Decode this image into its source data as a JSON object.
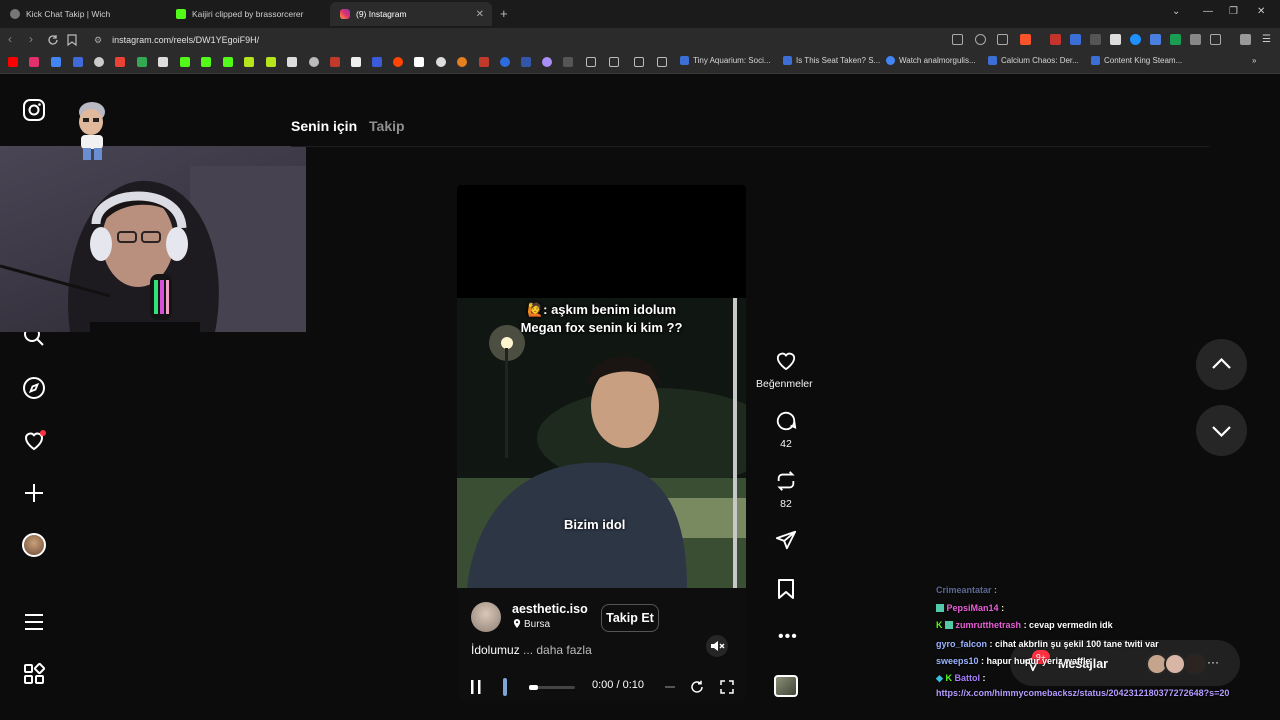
{
  "browser": {
    "tabs": [
      {
        "title": "Kick Chat Takip | Wich"
      },
      {
        "title": "Kaijiri clipped by brassorcerer"
      },
      {
        "title": "(9) Instagram"
      }
    ],
    "url": "instagram.com/reels/DW1YEgoiF9H/",
    "bookmarks": [
      "Tiny Aquarium: Soci...",
      "Is This Seat Taken? S...",
      "Watch analmorgulis...",
      "Calcium Chaos: Der...",
      "Content King Steam..."
    ]
  },
  "instagram": {
    "feed_tabs": {
      "for_you": "Senin için",
      "following": "Takip"
    },
    "reel": {
      "caption_line1": ": aşkım benim idolum",
      "caption_line2": "Megan fox senin ki kim ??",
      "caption_emoji": "🙋",
      "caption_mid": "Bizim idol",
      "username": "aesthetic.iso",
      "location": "Bursa",
      "follow_label": "Takip Et",
      "description": "İdolumuz",
      "more_label": "... daha fazla",
      "time": "0:00 / 0:10",
      "progress": 0.0
    },
    "actions": {
      "likes_label": "Beğenmeler",
      "comments_count": "42",
      "reposts_count": "82"
    },
    "messages": {
      "label": "Mesajlar",
      "badge": "9+"
    }
  },
  "chat": [
    {
      "nick": "Crimeantatar",
      "msg": ":"
    },
    {
      "nick": "PepsiMan14",
      "msg": ":"
    },
    {
      "nick": "zumrutthetrash",
      "msg": ": cevap vermedin idk"
    },
    {
      "nick": "gyro_falcon",
      "msg": ": cihat akbrlin şu şekil 100 tane twiti var"
    },
    {
      "nick": "sweeps10",
      "msg": ": hapur hupur yeriz waffle"
    },
    {
      "nick": "Battol",
      "msg": ":"
    },
    {
      "nick": "",
      "msg": "https://x.com/himmycomebacksz/status/2042312180377272648?s=20"
    }
  ],
  "colors": {
    "accent_red": "#ff3040",
    "chat_nick": "#9ab4ff",
    "link": "#b49bff"
  }
}
